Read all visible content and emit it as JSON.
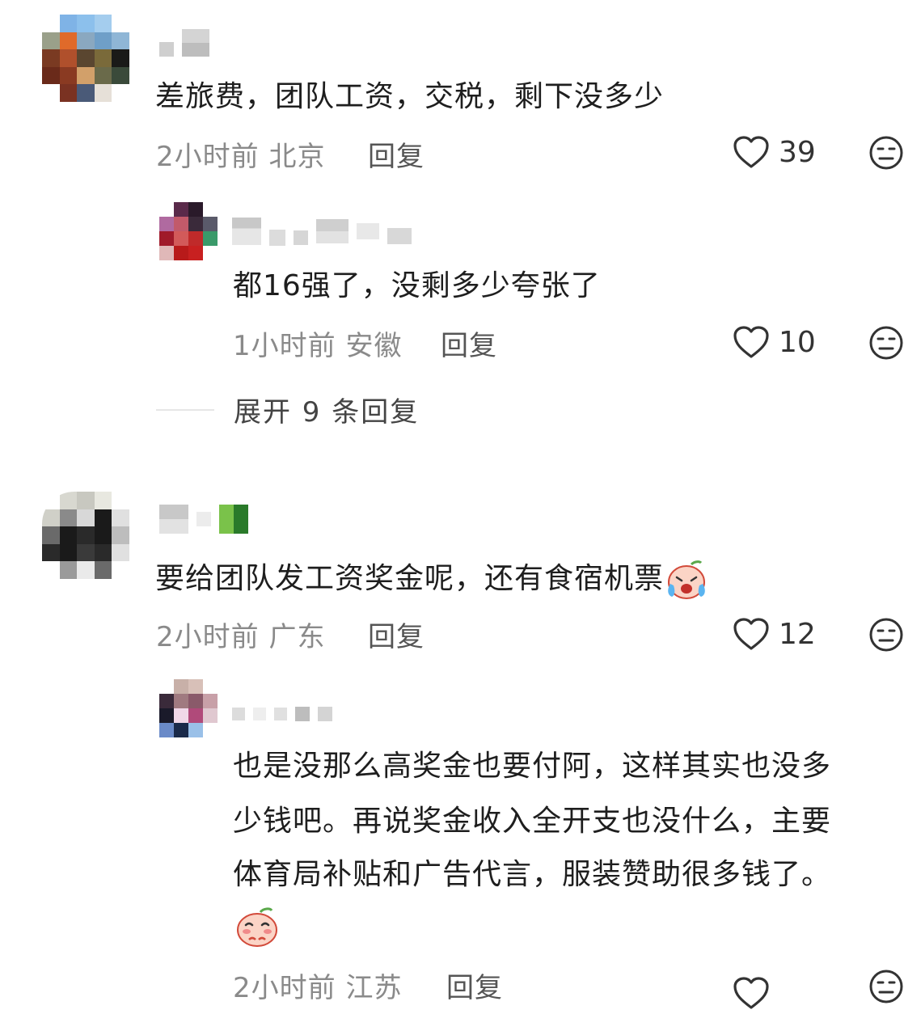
{
  "comments": [
    {
      "text": "差旅费，团队工资，交税，剩下没多少",
      "time": "2小时前",
      "location": "北京",
      "reply_label": "回复",
      "likes": "39"
    },
    {
      "text": "都16强了，没剩多少夸张了",
      "time": "1小时前",
      "location": "安徽",
      "reply_label": "回复",
      "likes": "10"
    },
    {
      "text": "要给团队发工资奖金呢，还有食宿机票",
      "emoji": "crying-emoji",
      "time": "2小时前",
      "location": "广东",
      "reply_label": "回复",
      "likes": "12"
    },
    {
      "lines": [
        "也是没那么高奖金也要付阿，这样其实也没多",
        "少钱吧。再说奖金收入全开支也没什么，主要",
        "体育局补贴和广告代言，服装赞助很多钱了。"
      ],
      "emoji": "shy-emoji",
      "time": "2小时前",
      "location": "江苏",
      "reply_label": "回复"
    }
  ],
  "expand_replies": "展开 9 条回复",
  "icons": {
    "like": "heart-outline-icon",
    "dislike": "neutral-face-icon"
  },
  "colors": {
    "text": "#1e1e1e",
    "meta": "#8a8a8a",
    "icon": "#333333"
  }
}
